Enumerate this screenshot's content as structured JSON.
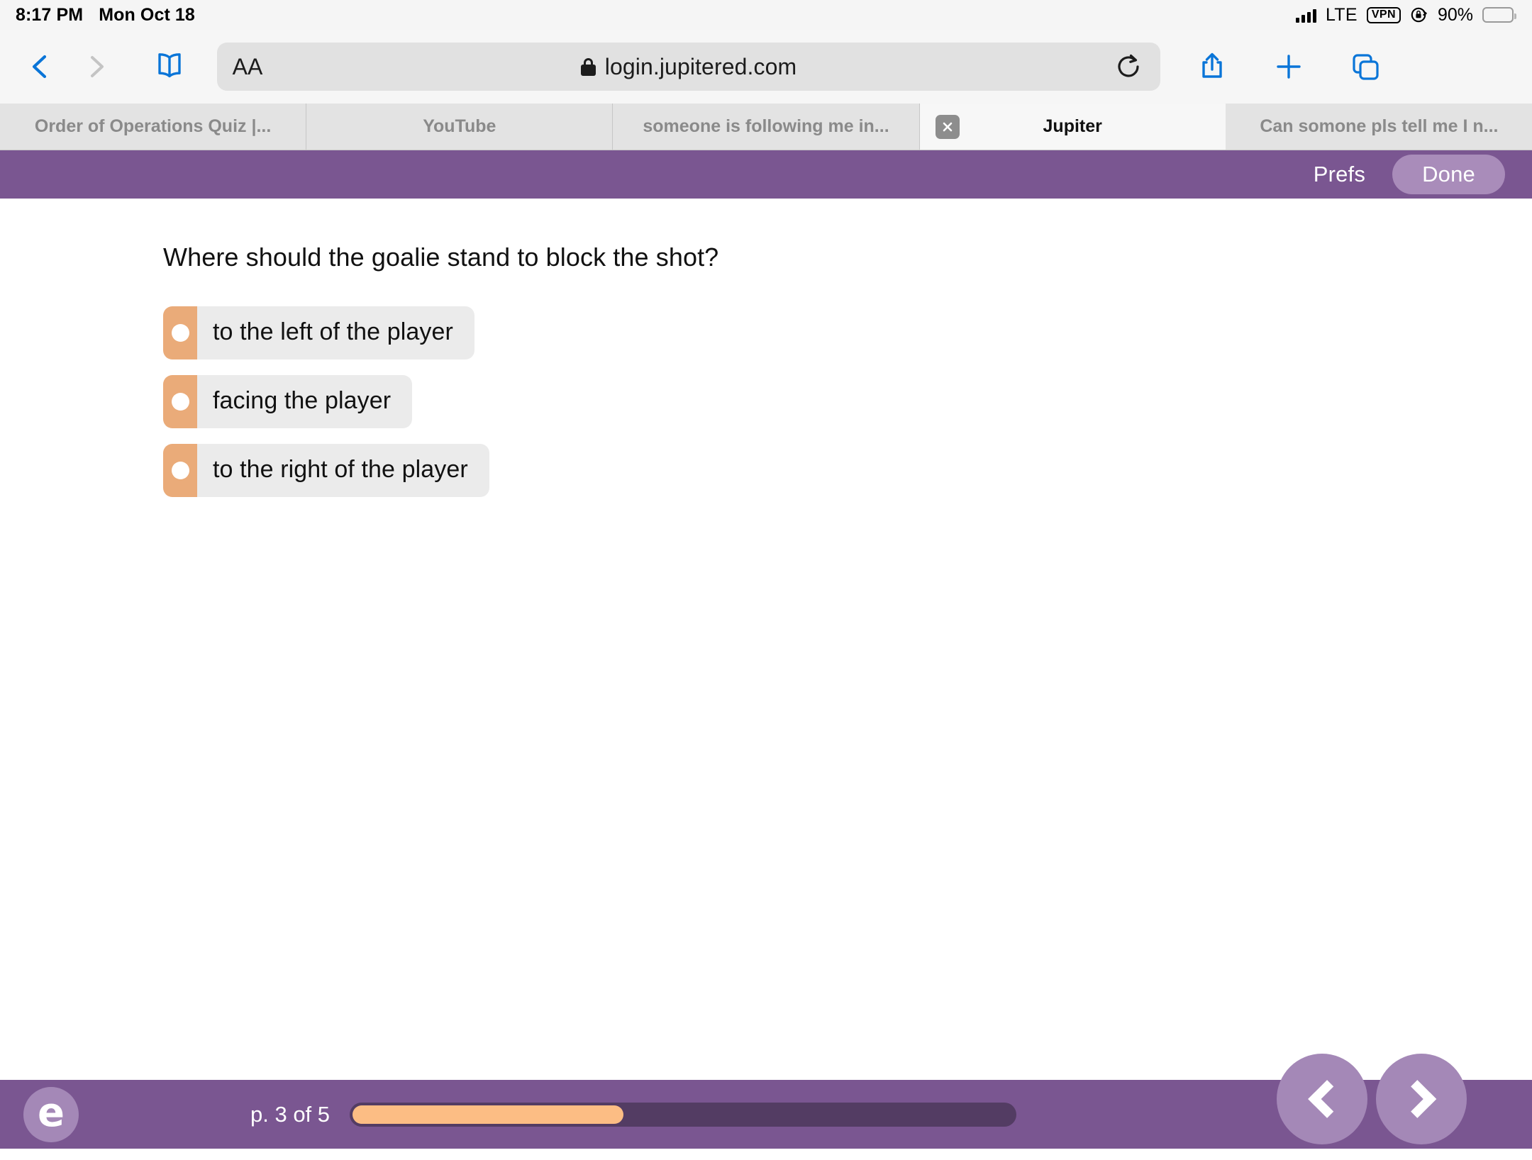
{
  "statusbar": {
    "time": "8:17 PM",
    "date": "Mon Oct 18",
    "network": "LTE",
    "vpn": "VPN",
    "battery_percent": "90%",
    "icons": [
      "signal-bars-icon",
      "vpn-badge-icon",
      "rotation-lock-icon",
      "battery-icon"
    ]
  },
  "browser": {
    "url": "login.jupitered.com",
    "text_size_label": "AA",
    "icons": {
      "back": "back-chevron-icon",
      "forward": "forward-chevron-icon",
      "bookmarks": "book-icon",
      "lock": "lock-icon",
      "reload": "reload-icon",
      "share": "share-icon",
      "new_tab": "plus-icon",
      "tabs_overview": "tabs-overview-icon"
    },
    "tabs": [
      {
        "label": "Order of Operations Quiz |...",
        "active": false,
        "closable": false
      },
      {
        "label": "YouTube",
        "active": false,
        "closable": false
      },
      {
        "label": "someone is following me in...",
        "active": false,
        "closable": false
      },
      {
        "label": "Jupiter",
        "active": true,
        "closable": true
      },
      {
        "label": "Can somone pls tell me I n...",
        "active": false,
        "closable": false
      }
    ],
    "close_tab_glyph": "×"
  },
  "quiz_header": {
    "prefs_label": "Prefs",
    "done_label": "Done"
  },
  "quiz": {
    "question": "Where should the goalie stand to block the shot?",
    "options": [
      {
        "label": "to the left of the player",
        "selected": false
      },
      {
        "label": "facing the player",
        "selected": false
      },
      {
        "label": "to the right of the player",
        "selected": false
      }
    ]
  },
  "footer": {
    "logo_glyph": "e",
    "page_counter": "p. 3 of 5",
    "progress_percent": 41,
    "prev_label": "prev-page",
    "next_label": "next-page"
  },
  "colors": {
    "purple": "#7a5691",
    "purple_light": "#a488b7",
    "purple_dark_track": "#533c63",
    "orange": "#eaab79",
    "orange_progress": "#fcbd84",
    "option_bg": "#ebebeb",
    "browser_blue": "#0a75d8"
  }
}
